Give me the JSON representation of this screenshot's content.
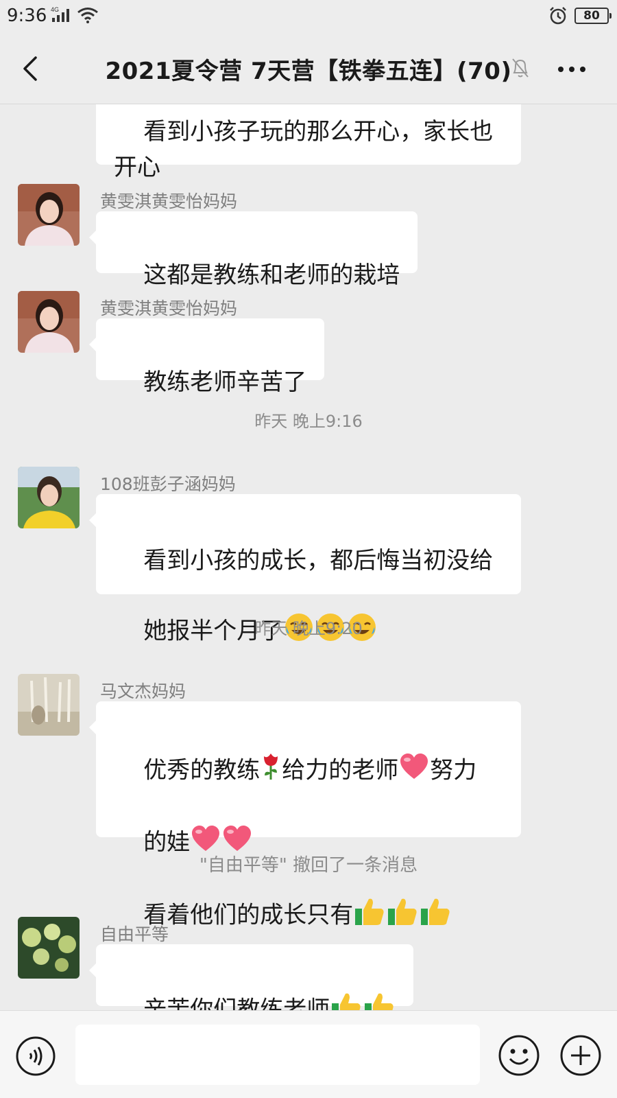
{
  "status_bar": {
    "time": "9:36",
    "network": "4G",
    "battery": "80"
  },
  "header": {
    "title": "2021夏令营 7天营【铁拳五连】(70)"
  },
  "messages": [
    {
      "type": "text",
      "text": "看到小孩子玩的那么开心，家长也开心"
    },
    {
      "type": "text",
      "sender": "黄雯淇黄雯怡妈妈",
      "text": "这都是教练和老师的栽培"
    },
    {
      "type": "text",
      "sender": "黄雯淇黄雯怡妈妈",
      "text": "教练老师辛苦了"
    },
    {
      "type": "time",
      "text": "昨天 晚上9:16"
    },
    {
      "type": "text",
      "sender": "108班彭子涵妈妈",
      "text_line1": "看到小孩的成长，都后悔当初没给",
      "text_line2": "她报半个月了"
    },
    {
      "type": "time",
      "text": "昨天 晚上9:20"
    },
    {
      "type": "text",
      "sender": "马文杰妈妈",
      "seg1": "优秀的教练",
      "seg2": "给力的老师",
      "seg3": "努力",
      "seg4": "的娃",
      "seg5": "看着他们的成长只有"
    },
    {
      "type": "system",
      "text": "\"自由平等\" 撤回了一条消息"
    },
    {
      "type": "text",
      "sender": "自由平等",
      "text": "辛苦你们教练老师"
    }
  ],
  "icons": {
    "back": "chevron-left-icon",
    "mute": "bell-off-icon",
    "more": "more-dots-icon",
    "voice": "voice-icon",
    "emoji": "smiley-icon",
    "plus": "plus-icon"
  },
  "colors": {
    "background": "#ececec",
    "bubble": "#ffffff",
    "header": "#ededed"
  }
}
